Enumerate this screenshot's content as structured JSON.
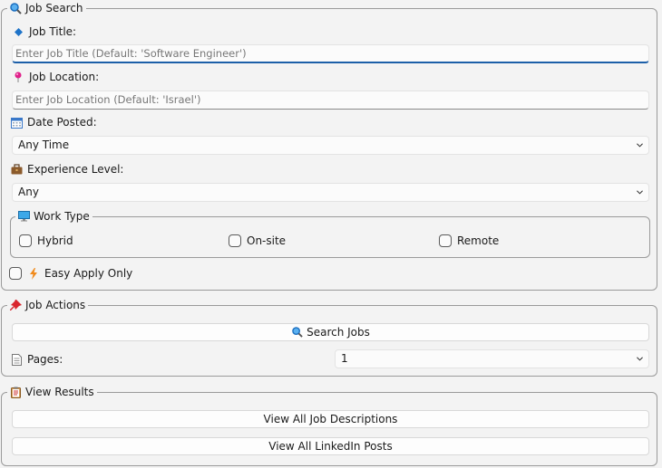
{
  "job_search": {
    "title": "Job Search",
    "job_title_label": "Job Title:",
    "job_title_placeholder": "Enter Job Title (Default: 'Software Engineer')",
    "job_location_label": "Job Location:",
    "job_location_placeholder": "Enter Job Location (Default: 'Israel')",
    "date_posted_label": "Date Posted:",
    "date_posted_value": "Any Time",
    "experience_label": "Experience Level:",
    "experience_value": "Any",
    "work_type": {
      "title": "Work Type",
      "options": [
        "Hybrid",
        "On-site",
        "Remote"
      ]
    },
    "easy_apply_label": "Easy Apply Only"
  },
  "job_actions": {
    "title": "Job Actions",
    "search_button": "Search Jobs",
    "pages_label": "Pages:",
    "pages_value": "1"
  },
  "view_results": {
    "title": "View Results",
    "descriptions_button": "View All Job Descriptions",
    "posts_button": "View All LinkedIn Posts"
  },
  "colors": {
    "focus_underline": "#1c5fa8",
    "window_bg": "#f3f3f3"
  }
}
